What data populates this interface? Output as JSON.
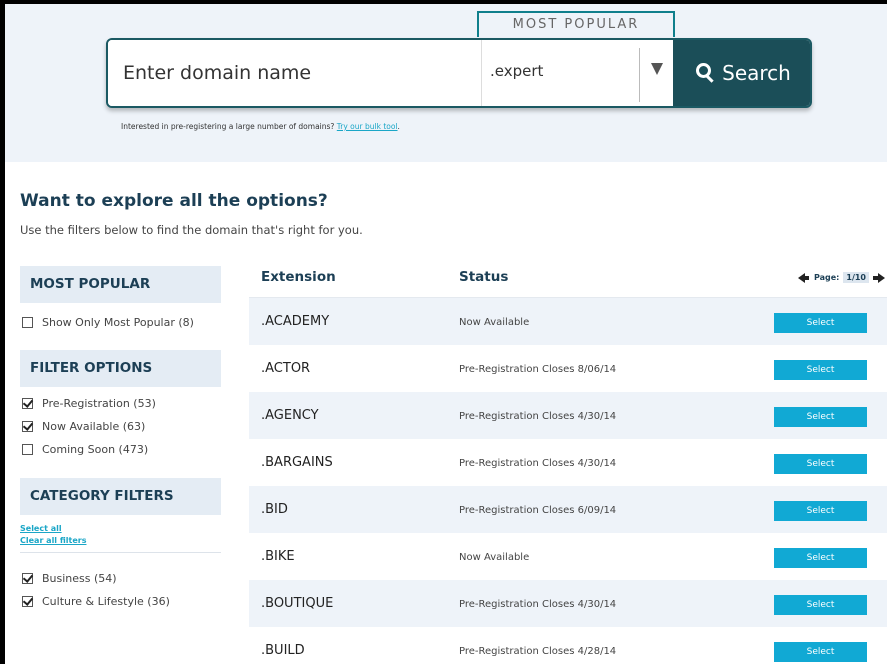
{
  "search": {
    "most_popular_tab": "MOST POPULAR",
    "placeholder": "Enter domain name",
    "tld_selected": ".expert",
    "button_label": "Search",
    "bulk_note": "Interested in pre-registering a large number of domains?",
    "bulk_link": "Try our bulk tool",
    "bulk_period": "."
  },
  "explore": {
    "title": "Want to explore all the options?",
    "subtitle": "Use the filters below to find the domain that's right for you."
  },
  "sidebar": {
    "most_popular": {
      "heading": "MOST POPULAR",
      "items": [
        {
          "label": "Show Only Most Popular (8)",
          "checked": false
        }
      ]
    },
    "filter_options": {
      "heading": "FILTER OPTIONS",
      "items": [
        {
          "label": "Pre-Registration (53)",
          "checked": true
        },
        {
          "label": "Now Available (63)",
          "checked": true
        },
        {
          "label": "Coming Soon (473)",
          "checked": false
        }
      ]
    },
    "category_filters": {
      "heading": "CATEGORY FILTERS",
      "select_all": "Select all",
      "clear_all": "Clear all filters",
      "items": [
        {
          "label": "Business (54)",
          "checked": true
        },
        {
          "label": "Culture & Lifestyle (36)",
          "checked": true
        }
      ]
    }
  },
  "table": {
    "col_extension": "Extension",
    "col_status": "Status",
    "pager_label": "Page:",
    "pager_current": "1",
    "pager_total": "/10",
    "select_label": "Select",
    "rows": [
      {
        "ext": ".ACADEMY",
        "status": "Now Available"
      },
      {
        "ext": ".ACTOR",
        "status": "Pre-Registration Closes 8/06/14"
      },
      {
        "ext": ".AGENCY",
        "status": "Pre-Registration Closes 4/30/14"
      },
      {
        "ext": ".BARGAINS",
        "status": "Pre-Registration Closes 4/30/14"
      },
      {
        "ext": ".BID",
        "status": "Pre-Registration Closes 6/09/14"
      },
      {
        "ext": ".BIKE",
        "status": "Now Available"
      },
      {
        "ext": ".BOUTIQUE",
        "status": "Pre-Registration Closes 4/30/14"
      },
      {
        "ext": ".BUILD",
        "status": "Pre-Registration Closes 4/28/14"
      }
    ]
  },
  "colors": {
    "accent": "#11a9d4",
    "search_button": "#1b4e58",
    "heading_text": "#1c3f55",
    "band_bg": "#eef3f9"
  }
}
